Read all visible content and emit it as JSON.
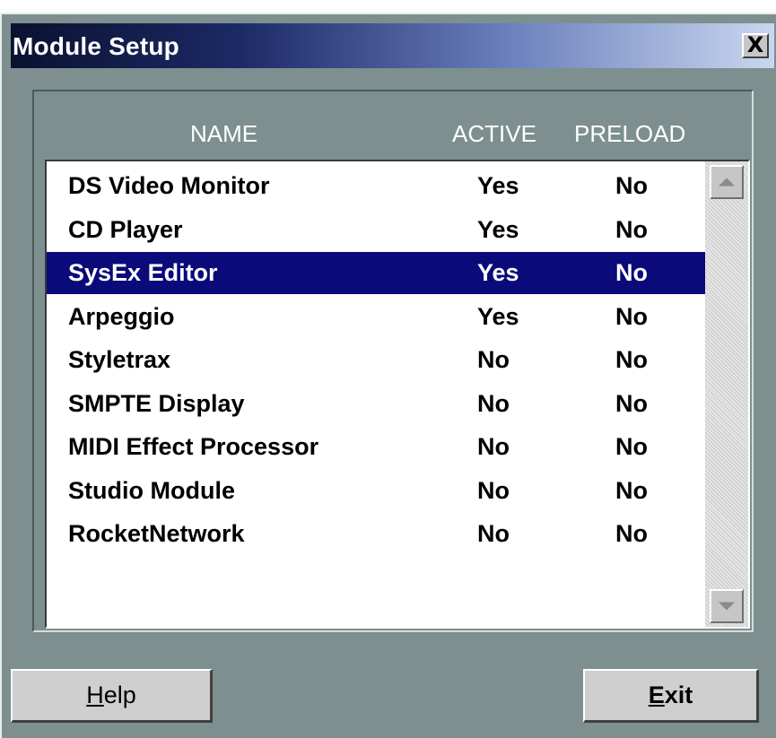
{
  "window": {
    "title": "Module Setup",
    "close_label": "X"
  },
  "columns": {
    "name": "NAME",
    "active": "ACTIVE",
    "preload": "PRELOAD"
  },
  "modules": [
    {
      "name": "DS Video Monitor",
      "active": "Yes",
      "preload": "No"
    },
    {
      "name": "CD Player",
      "active": "Yes",
      "preload": "No"
    },
    {
      "name": "SysEx Editor",
      "active": "Yes",
      "preload": "No"
    },
    {
      "name": "Arpeggio",
      "active": "Yes",
      "preload": "No"
    },
    {
      "name": "Styletrax",
      "active": "No",
      "preload": "No"
    },
    {
      "name": "SMPTE Display",
      "active": "No",
      "preload": "No"
    },
    {
      "name": "MIDI Effect Processor",
      "active": "No",
      "preload": "No"
    },
    {
      "name": "Studio Module",
      "active": "No",
      "preload": "No"
    },
    {
      "name": "RocketNetwork",
      "active": "No",
      "preload": "No"
    }
  ],
  "selected_module": "SysEx Editor",
  "scrollbar": {
    "up_icon": "arrow-up-icon",
    "down_icon": "arrow-down-icon"
  },
  "buttons": {
    "help_first": "H",
    "help_rest": "elp",
    "exit_first": "E",
    "exit_rest": "xit"
  },
  "colors": {
    "selection": "#0a0a7a",
    "window_bg": "#7e8f8f"
  }
}
